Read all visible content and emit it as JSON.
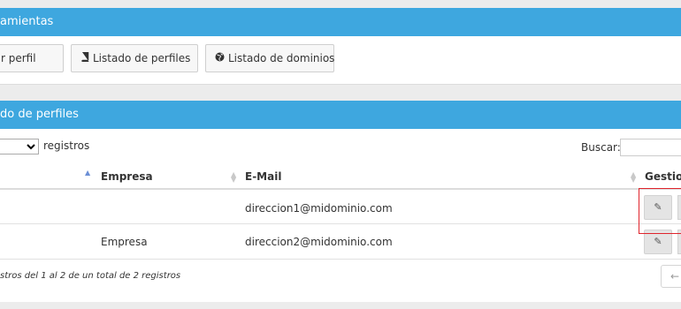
{
  "tools_panel": {
    "title": "amientas",
    "buttons": [
      {
        "label": "r perfil",
        "icon": ""
      },
      {
        "label": "Listado de perfiles",
        "icon": "book-icon"
      },
      {
        "label": "Listado de dominios",
        "icon": "globe-icon"
      }
    ]
  },
  "list_panel": {
    "title": "do de perfiles",
    "length_select": "",
    "length_suffix": "registros",
    "search_label": "Buscar:",
    "search_value": "",
    "columns": [
      "Empresa",
      "E-Mail",
      "Gestion"
    ],
    "rows": [
      {
        "empresa": "",
        "email": "direccion1@midominio.com"
      },
      {
        "empresa": "Empresa",
        "email": "direccion2@midominio.com"
      }
    ],
    "info": "stros del 1 al 2 de un total de 2 registros",
    "prev_label": "←"
  },
  "colors": {
    "header": "#3ea7df",
    "highlight": "#e0242c"
  }
}
